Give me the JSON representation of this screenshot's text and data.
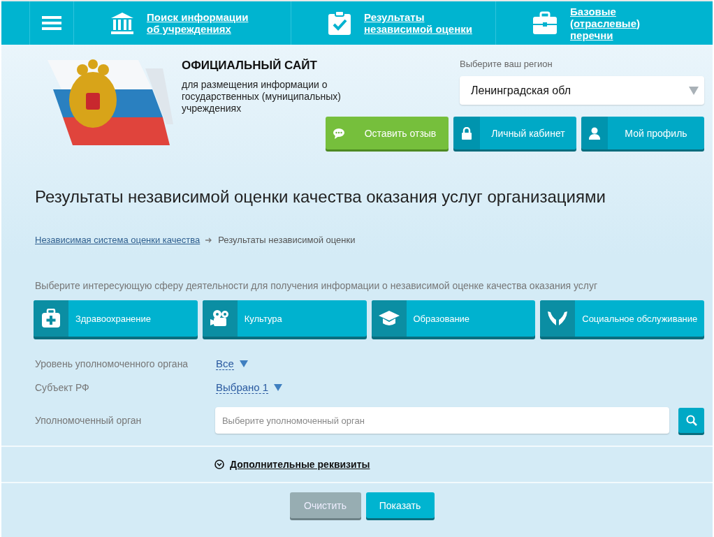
{
  "nav": {
    "items": [
      {
        "kind": "institutions",
        "label": "Поиск информации об учреждениях"
      },
      {
        "kind": "results",
        "label": "Результаты независимой оценки"
      },
      {
        "kind": "lists",
        "label": "Базовые (отраслевые) перечни"
      }
    ]
  },
  "header": {
    "title": "ОФИЦИАЛЬНЫЙ САЙТ",
    "subtitle": "для размещения информации о государственных (муниципальных) учреждениях",
    "region": {
      "label": "Выберите ваш регион",
      "value": "Ленинградская обл"
    },
    "buttons": [
      {
        "kind": "feedback",
        "label": "Оставить отзыв"
      },
      {
        "kind": "lock",
        "label": "Личный кабинет"
      },
      {
        "kind": "profile",
        "label": "Мой профиль"
      }
    ]
  },
  "page_title": "Результаты независимой оценки качества оказания услуг организациями",
  "breadcrumb": {
    "link": "Независимая система оценки качества",
    "current": "Результаты независимой оценки"
  },
  "prompt": "Выберите интересующую сферу деятельности для получения информации о независимой оценке качества оказания услуг",
  "categories": [
    {
      "kind": "health",
      "label": "Здравоохранение"
    },
    {
      "kind": "culture",
      "label": "Культура"
    },
    {
      "kind": "education",
      "label": "Образование"
    },
    {
      "kind": "social",
      "label": "Социальное обслуживание"
    }
  ],
  "filters": [
    {
      "kind": "dropdown",
      "label": "Уровень уполномоченного органа",
      "value": "Все"
    },
    {
      "kind": "dropdown",
      "label": "Субъект РФ",
      "value": "Выбрано 1"
    },
    {
      "kind": "search",
      "label": "Уполномоченный орган",
      "placeholder": "Выберите уполномоченный орган"
    }
  ],
  "extra": {
    "label": "Дополнительные реквизиты",
    "expanded": false
  },
  "actions": [
    {
      "kind": "secondary",
      "label": "Очистить"
    },
    {
      "kind": "primary",
      "label": "Показать"
    }
  ]
}
